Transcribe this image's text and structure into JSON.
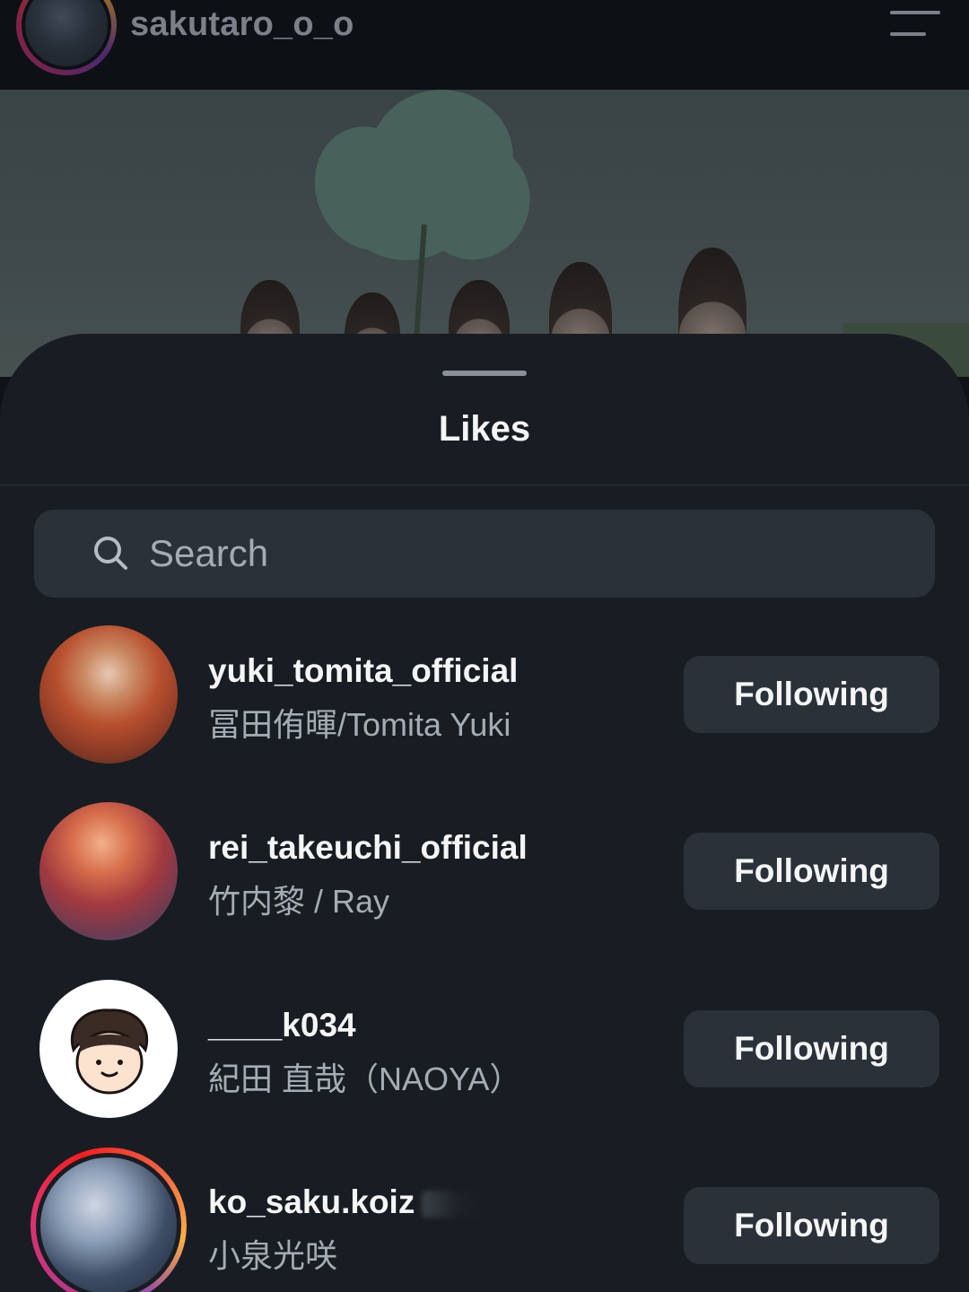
{
  "header": {
    "username": "sakutaro_o_o",
    "menu_icon": "hamburger-menu-icon"
  },
  "sheet": {
    "title": "Likes"
  },
  "search": {
    "placeholder": "Search",
    "value": "",
    "icon": "search-icon"
  },
  "users": [
    {
      "username": "yuki_tomita_official",
      "full_name": "冨田侑暉/Tomita Yuki",
      "button": "Following"
    },
    {
      "username": "rei_takeuchi_official",
      "full_name": "竹内黎 / Ray",
      "button": "Following"
    },
    {
      "username": "____k034",
      "full_name": "紀田 直哉（NAOYA）",
      "button": "Following"
    },
    {
      "username": "ko_saku.koiz",
      "full_name": "小泉光咲",
      "button": "Following",
      "has_story": true
    }
  ],
  "colors": {
    "sheet_bg": "#181d23",
    "button_bg": "#2a3139",
    "secondary_text": "#a6acb4",
    "story_ring": "#e1306c"
  }
}
